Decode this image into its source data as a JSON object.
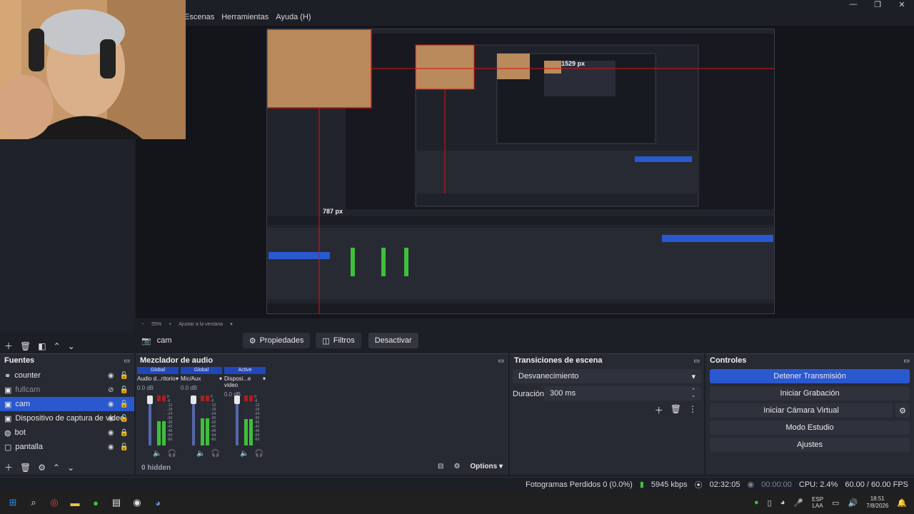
{
  "menu": {
    "items": [
      "Escenas",
      "Herramientas",
      "Ayuda (H)"
    ]
  },
  "window_controls": {
    "minimize": "—",
    "maximize": "❐",
    "close": "✕"
  },
  "preview": {
    "measure_width": "1529 px",
    "measure_height": "787 px",
    "zoom": "55%",
    "zoom_fit": "Ajustar a la ventana",
    "zoom_minus": "−",
    "zoom_plus": "+"
  },
  "source_toolbar": {
    "selected_source": "cam",
    "properties": "Propiedades",
    "filters": "Filtros",
    "deactivate": "Desactivar"
  },
  "sources": {
    "title": "Fuentes",
    "items": [
      {
        "label": "counter",
        "visible": true,
        "locked": false
      },
      {
        "label": "fullcam",
        "visible": false,
        "locked": false
      },
      {
        "label": "cam",
        "visible": true,
        "locked": false,
        "selected": true
      },
      {
        "label": "Dispositivo de captura de video",
        "visible": true,
        "locked": false
      },
      {
        "label": "bot",
        "visible": true,
        "locked": true
      },
      {
        "label": "pantalla",
        "visible": true,
        "locked": false
      }
    ]
  },
  "mixer": {
    "title": "Mezclador de audio",
    "channels": [
      {
        "badge": "Global",
        "name": "Audio d...ritorio",
        "db": "0.0 dB",
        "level": 0.55
      },
      {
        "badge": "Global",
        "name": "Mic/Aux",
        "db": "0.0 dB",
        "level": 0.62
      },
      {
        "badge": "Active",
        "name": "Disposi...e video",
        "db": "0.0 dB",
        "level": 0.6
      }
    ],
    "scale": [
      "0",
      "-6",
      "-12",
      "-18",
      "-24",
      "-30",
      "-36",
      "-42",
      "-48",
      "-54",
      "-60"
    ],
    "hidden": "0 hidden",
    "options": "Options"
  },
  "transitions": {
    "title": "Transiciones de escena",
    "selected": "Desvanecimiento",
    "duration_label": "Duración",
    "duration_value": "300 ms"
  },
  "controls": {
    "title": "Controles",
    "stop_stream": "Detener Transmisión",
    "start_recording": "Iniciar Grabación",
    "start_virtual_cam": "Iniciar Cámara Virtual",
    "studio_mode": "Modo Estudio",
    "settings": "Ajustes"
  },
  "status": {
    "dropped_frames": "Fotogramas Perdidos 0 (0.0%)",
    "bitrate": "5945 kbps",
    "stream_time": "02:32:05",
    "record_time": "00:00:00",
    "cpu": "CPU: 2.4%",
    "fps": "60.00 / 60.00 FPS"
  },
  "taskbar": {
    "lang_top": "ESP",
    "lang_bottom": "LAA",
    "time": "18:51",
    "date": "7/8/2026"
  },
  "colors": {
    "accent": "#2a58cf",
    "guide_red": "#e01010",
    "meter_green": "#3fbf3a"
  }
}
